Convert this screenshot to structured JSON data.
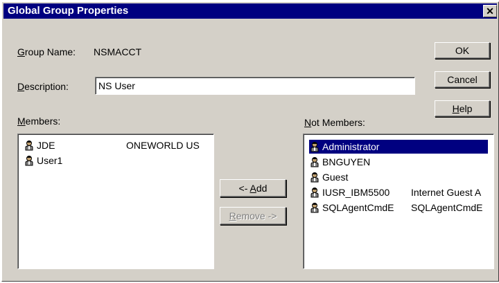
{
  "window": {
    "title": "Global Group Properties",
    "close_glyph": "✕"
  },
  "group_name": {
    "label_prefix": "G",
    "label_rest": "roup Name:",
    "value": "NSMACCT"
  },
  "description": {
    "label_prefix": "D",
    "label_rest": "escription:",
    "value": "NS User"
  },
  "members": {
    "label_prefix": "M",
    "label_rest": "embers:",
    "items": [
      {
        "name": "JDE",
        "desc": "ONEWORLD US"
      },
      {
        "name": "User1",
        "desc": ""
      }
    ]
  },
  "not_members": {
    "label_prefix": "N",
    "label_rest": "ot Members:",
    "items": [
      {
        "name": "Administrator",
        "desc": "",
        "selected": true
      },
      {
        "name": "BNGUYEN",
        "desc": ""
      },
      {
        "name": "Guest",
        "desc": ""
      },
      {
        "name": "IUSR_IBM5500",
        "desc": "Internet Guest A"
      },
      {
        "name": "SQLAgentCmdE",
        "desc": "SQLAgentCmdE"
      }
    ]
  },
  "buttons": {
    "ok": "OK",
    "cancel": "Cancel",
    "help_prefix": "H",
    "help_rest": "elp",
    "add_pre": "<- ",
    "add_u": "A",
    "add_rest": "dd",
    "remove_u": "R",
    "remove_rest": "emove ->"
  },
  "icons": {
    "user": "user-icon"
  },
  "colors": {
    "title_bar": "#000080",
    "selection": "#000080",
    "face": "#d4d0c8"
  }
}
